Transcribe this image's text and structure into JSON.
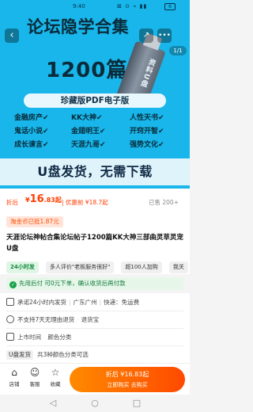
{
  "status_bar": {
    "time": "9:40",
    "icons": "⊠ ⊙ ⌁ ▮▮",
    "battery": "6"
  },
  "hero": {
    "title": "论坛隐学合集",
    "number": "1200篇",
    "usb_text": "资料U盘",
    "ribbon": "珍藏版PDF电子版",
    "tags": [
      "金融房产✔",
      "KK大神✔",
      "人性天书✔",
      "鬼话小说✔",
      "金翅明王✔",
      "开窍开智✔",
      "成长谏言✔",
      "天涯九哥✔",
      "强势文化✔"
    ],
    "footer": "U盘发货，无需下载",
    "page_indicator": "1/1",
    "back_icon": "chevron-left-icon",
    "fav_icon": "share-icon",
    "more_icon": "more-icon"
  },
  "price": {
    "label": "折后",
    "symbol": "¥",
    "integer": "16",
    "decimal": ".83",
    "suffix": "起",
    "original": "| 优惠前 ¥18.7起",
    "sold": "已售 200+"
  },
  "coupon": "淘金币已抵1.87元",
  "product_title": "天涯论坛神帖合集论坛帖子1200篇KK大神三部曲灵草灵宠U盘",
  "service_chips": [
    {
      "label": "24小时发",
      "style": "green"
    },
    {
      "label": "多人评价\"老板服务很好\"",
      "style": ""
    },
    {
      "label": "超100人加购",
      "style": ""
    },
    {
      "label": "我关",
      "style": ""
    }
  ],
  "free_use": "先用后付 可0元下单，确认收货后再付款",
  "info": {
    "shipping_promise": "承诺24小时内发货",
    "shipping_from": "广东广州",
    "shipping_fee": "快递：免运费",
    "no_return": "不支持7天无理由退货",
    "return_note": "退货宝",
    "launch": "上市时间",
    "param": "颜色分类",
    "spec_label": "U盘发货",
    "spec_value": "共3种颜色分类可选"
  },
  "bottom_bar": {
    "store": "店铺",
    "service": "客服",
    "collect": "收藏",
    "buy_line1": "折后 ¥16.83起",
    "buy_line2": "立即购买 去购买"
  }
}
